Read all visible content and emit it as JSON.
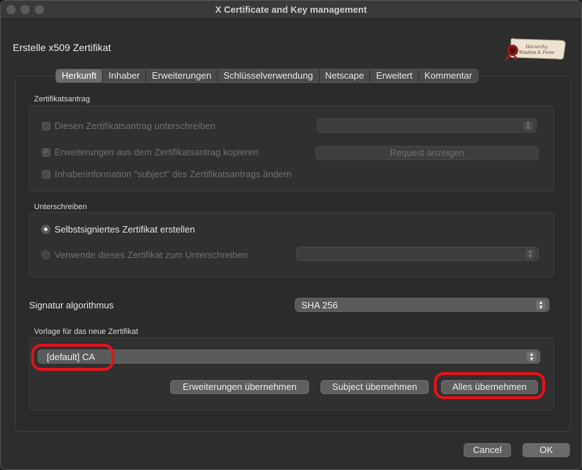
{
  "window": {
    "title": "X Certificate and Key management"
  },
  "dialog": {
    "title": "Erstelle x509 Zertifikat"
  },
  "tabs": [
    {
      "label": "Herkunft",
      "active": true
    },
    {
      "label": "Inhaber"
    },
    {
      "label": "Erweiterungen"
    },
    {
      "label": "Schlüsselverwendung"
    },
    {
      "label": "Netscape"
    },
    {
      "label": "Erweitert"
    },
    {
      "label": "Kommentar"
    }
  ],
  "csr_group": {
    "label": "Zertifikatsantrag",
    "sign_request": {
      "label": "Diesen Zertifikatsantrag unterschreiben",
      "checked": false,
      "enabled": false
    },
    "request_select": {
      "value": ""
    },
    "copy_extensions": {
      "label": "Erweiterungen aus dem Zertifikatsantrag kopieren",
      "checked": true,
      "enabled": false
    },
    "show_request_button": "Request anzeigen",
    "modify_subject": {
      "label": "Inhaberinformation \"subject\" des Zertifikatsantrags ändern",
      "checked": false,
      "enabled": false
    }
  },
  "sign_group": {
    "label": "Unterschreiben",
    "self_signed": {
      "label": "Selbstsigniertes Zertifikat erstellen",
      "selected": true
    },
    "use_cert": {
      "label": "Verwende dieses Zertifikat zum Unterschreiben",
      "selected": false,
      "enabled": false
    },
    "signer_select": {
      "value": ""
    }
  },
  "signature": {
    "label": "Signatur algorithmus",
    "value": "SHA 256"
  },
  "template_group": {
    "label": "Vorlage für das neue Zertifikat",
    "template_select": {
      "value": "[default] CA"
    },
    "apply_extensions_button": "Erweiterungen übernehmen",
    "apply_subject_button": "Subject übernehmen",
    "apply_all_button": "Alles übernehmen"
  },
  "footer": {
    "cancel_button": "Cancel",
    "ok_button": "OK"
  },
  "logo": {
    "text_line1": "Hierarchy",
    "text_line2": "Wisdom & Fame"
  },
  "colors": {
    "annotation": "#e3131b",
    "window_bg": "#2d2d2d"
  }
}
